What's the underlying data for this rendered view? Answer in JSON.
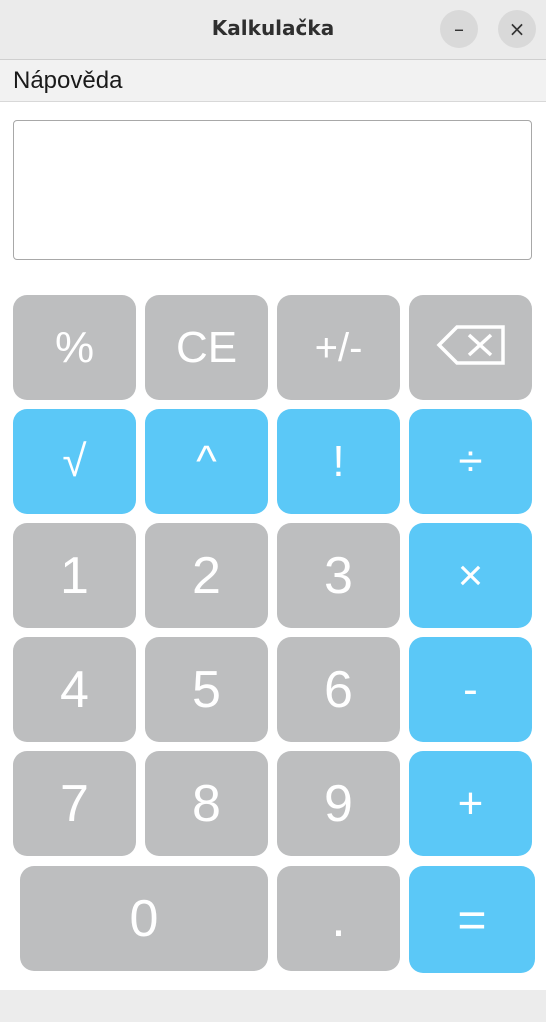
{
  "window": {
    "title": "Kalkulačka",
    "minimize_label": "–",
    "close_label": "×"
  },
  "menu": {
    "items": [
      {
        "label": "Nápověda"
      }
    ]
  },
  "display": {
    "value": ""
  },
  "keypad": {
    "row1": {
      "percent": "%",
      "clear_entry": "CE",
      "negate": "+/-",
      "backspace": "⌫"
    },
    "row2": {
      "sqrt": "√",
      "power": "^",
      "factorial": "!",
      "divide": "÷"
    },
    "row3": {
      "one": "1",
      "two": "2",
      "three": "3",
      "multiply": "×"
    },
    "row4": {
      "four": "4",
      "five": "5",
      "six": "6",
      "subtract": "-"
    },
    "row5": {
      "seven": "7",
      "eight": "8",
      "nine": "9",
      "add": "+"
    },
    "row6": {
      "zero": "0",
      "decimal": ".",
      "equals": "="
    }
  },
  "colors": {
    "function_key": "#bdbebf",
    "operator_key": "#5bc8f7",
    "key_text": "#ffffff"
  }
}
